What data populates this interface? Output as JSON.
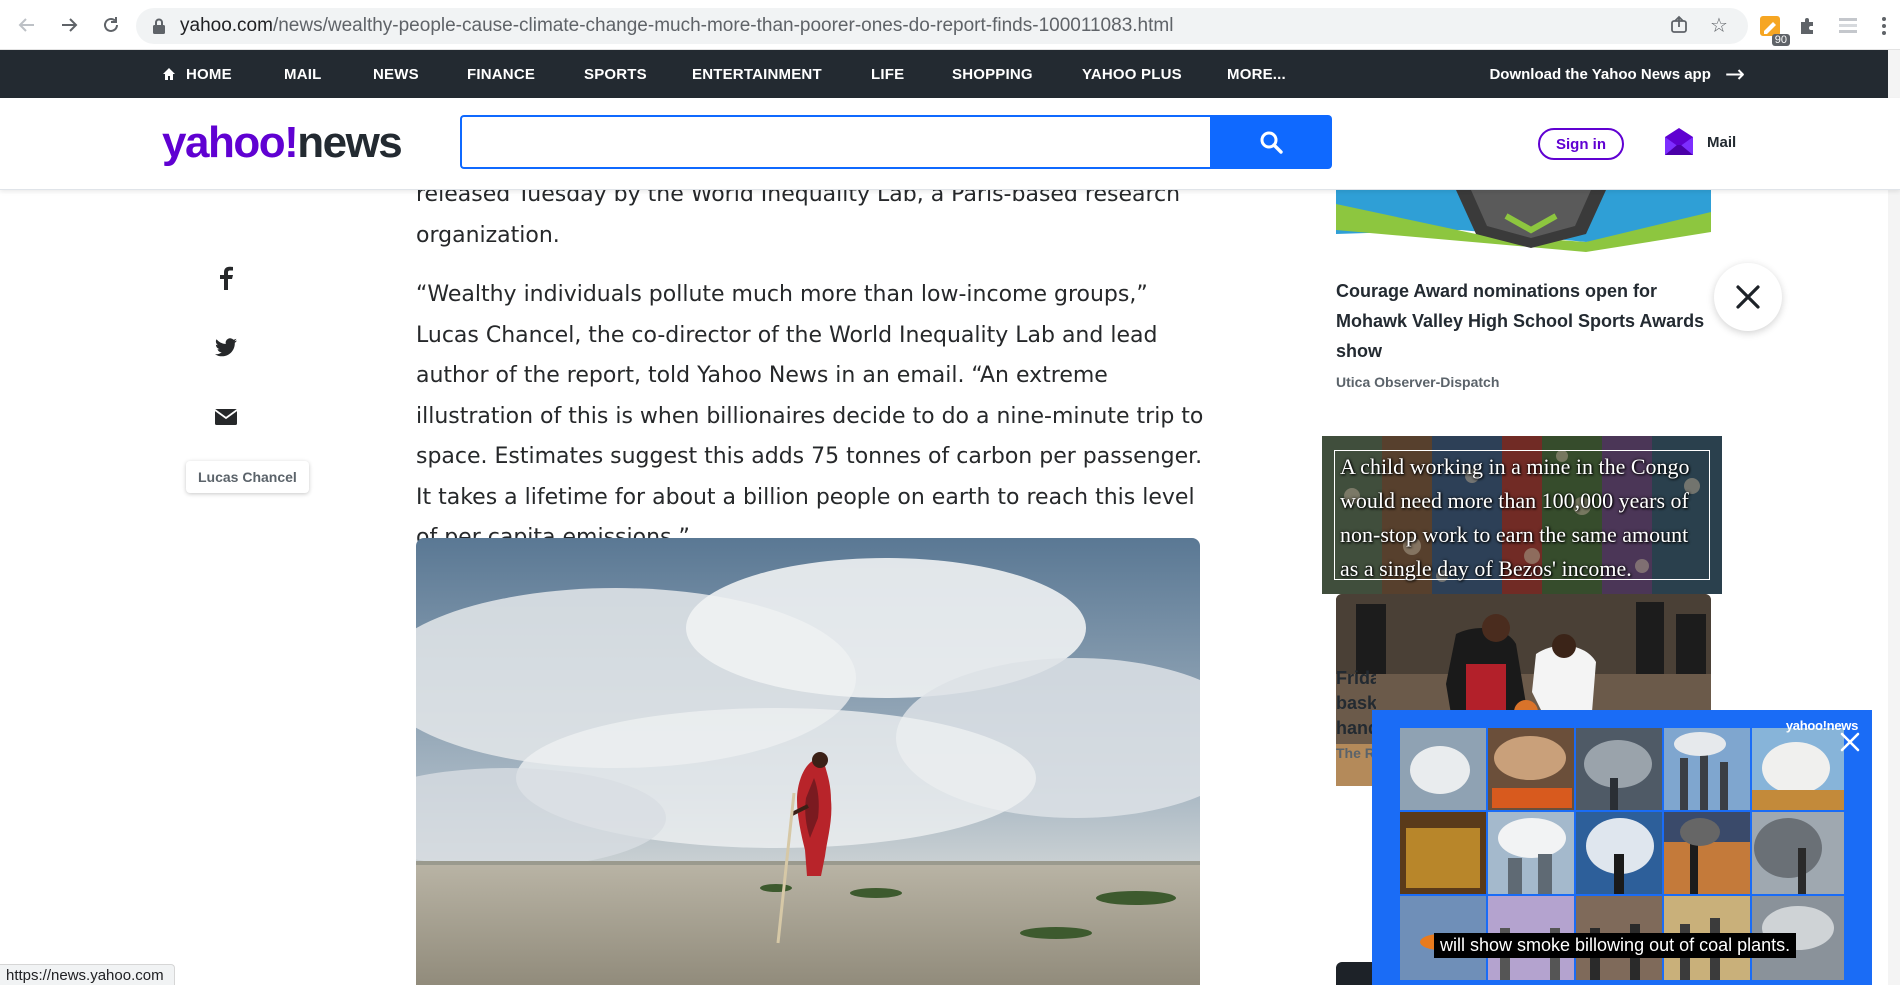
{
  "browser": {
    "url_host": "yahoo.com",
    "url_path": "/news/wealthy-people-cause-climate-change-much-more-than-poorer-ones-do-report-finds-100011083.html",
    "extension_badge": "90"
  },
  "topnav": {
    "items": [
      "HOME",
      "MAIL",
      "NEWS",
      "FINANCE",
      "SPORTS",
      "ENTERTAINMENT",
      "LIFE",
      "SHOPPING",
      "YAHOO PLUS",
      "MORE..."
    ],
    "download_app": "Download the Yahoo News app"
  },
  "header": {
    "logo_brand": "yahoo!",
    "logo_product": "news",
    "search_placeholder": "",
    "signin_label": "Sign in",
    "mail_label": "Mail"
  },
  "article": {
    "paragraphs": [
      "released Tuesday by the World Inequality Lab, a Paris-based research organization.",
      "“Wealthy individuals pollute much more than low-income groups,” Lucas Chancel, the co-director of the World Inequality Lab and lead author of the report, told Yahoo News in an email. “An extreme illustration of this is when billionaires decide to do a nine-minute trip to space. Estimates suggest this adds 75 tonnes of carbon per passenger. It takes a lifetime for about a billion people on earth to reach this level of per capita emissions.”"
    ]
  },
  "share": {
    "author_chip": "Lucas Chancel"
  },
  "rail": {
    "story1_title": "Courage Award nominations open for Mohawk Valley High School Sports Awards show",
    "story1_source": "Utica Observer-Dispatch",
    "quote_text": "A child working in a mine in the Congo would need more than 100,000 years of non-stop work to earn the same amount as a single day of Bezos' income.",
    "story2_partial_lines": [
      "Frida",
      "bask",
      "hand"
    ],
    "story2_partial_source": "The R"
  },
  "video": {
    "brand": "yahoo!news",
    "caption": "will show smoke billowing out of coal plants."
  },
  "status_url": "https://news.yahoo.com",
  "colors": {
    "yahoo_purple": "#6001d2",
    "search_blue": "#0f69ff",
    "nav_dark": "#232a31",
    "video_blue": "#1a6cf6"
  }
}
